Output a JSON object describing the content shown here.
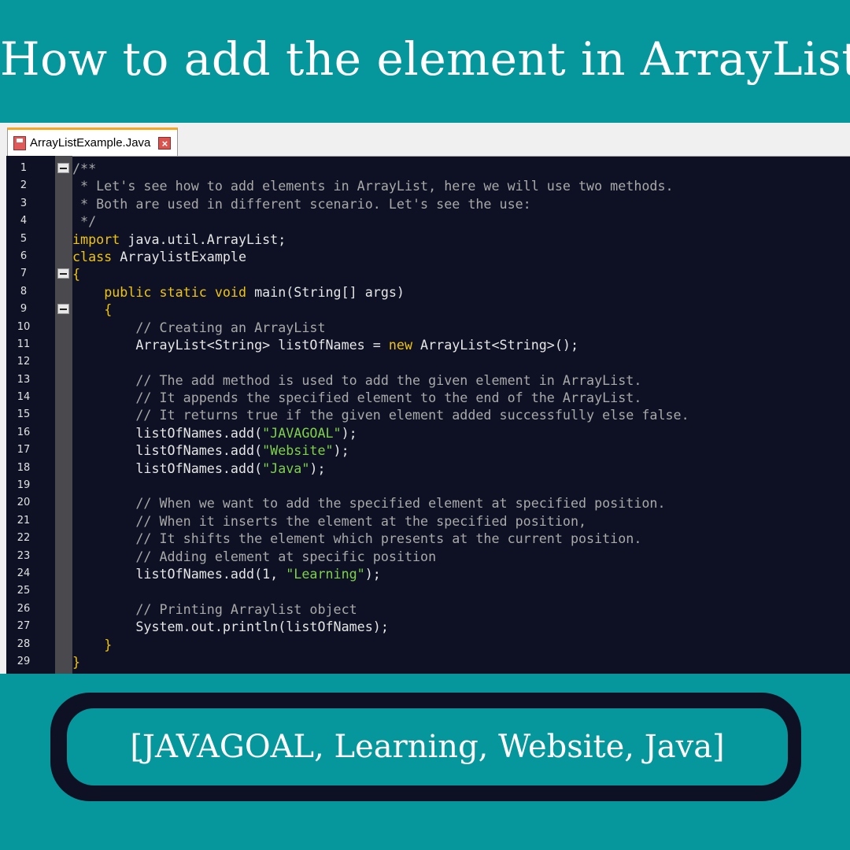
{
  "header": {
    "title": "How to add the element in ArrayList"
  },
  "editor": {
    "tab_label": "ArrayListExample.Java",
    "colors": {
      "background": "#0d1123",
      "comment": "#a9a9a9",
      "keyword": "#f1c40f",
      "string": "#7fd14a",
      "text": "#e6e6e6"
    },
    "lines": [
      {
        "n": "1",
        "fold": true,
        "tokens": [
          {
            "t": "/**",
            "c": "comment"
          }
        ]
      },
      {
        "n": "2",
        "tokens": [
          {
            "t": " * Let's see how to add elements in ArrayList, here we will use two methods.",
            "c": "comment"
          }
        ]
      },
      {
        "n": "3",
        "tokens": [
          {
            "t": " * Both are used in different scenario. Let's see the use:",
            "c": "comment"
          }
        ]
      },
      {
        "n": "4",
        "tokens": [
          {
            "t": " */",
            "c": "comment"
          }
        ]
      },
      {
        "n": "5",
        "tokens": [
          {
            "t": "import",
            "c": "kw"
          },
          {
            "t": " java.util.ArrayList;",
            "c": "plain"
          }
        ]
      },
      {
        "n": "6",
        "tokens": [
          {
            "t": "class",
            "c": "kw"
          },
          {
            "t": " ArraylistExample",
            "c": "plain"
          }
        ]
      },
      {
        "n": "7",
        "fold": true,
        "tokens": [
          {
            "t": "{",
            "c": "brace"
          }
        ]
      },
      {
        "n": "8",
        "tokens": [
          {
            "t": "    ",
            "c": "plain"
          },
          {
            "t": "public static void",
            "c": "kw"
          },
          {
            "t": " main(String[] args)",
            "c": "plain"
          }
        ]
      },
      {
        "n": "9",
        "fold": true,
        "tokens": [
          {
            "t": "    ",
            "c": "plain"
          },
          {
            "t": "{",
            "c": "brace"
          }
        ]
      },
      {
        "n": "10",
        "tokens": [
          {
            "t": "        // Creating an ArrayList",
            "c": "comment"
          }
        ]
      },
      {
        "n": "11",
        "tokens": [
          {
            "t": "        ArrayList<String> listOfNames = ",
            "c": "plain"
          },
          {
            "t": "new",
            "c": "kw"
          },
          {
            "t": " ArrayList<String>();",
            "c": "plain"
          }
        ]
      },
      {
        "n": "12",
        "tokens": []
      },
      {
        "n": "13",
        "tokens": [
          {
            "t": "        // The add method is used to add the given element in ArrayList.",
            "c": "comment"
          }
        ]
      },
      {
        "n": "14",
        "tokens": [
          {
            "t": "        // It appends the specified element to the end of the ArrayList.",
            "c": "comment"
          }
        ]
      },
      {
        "n": "15",
        "tokens": [
          {
            "t": "        // It returns true if the given element added successfully else false.",
            "c": "comment"
          }
        ]
      },
      {
        "n": "16",
        "tokens": [
          {
            "t": "        listOfNames.add(",
            "c": "plain"
          },
          {
            "t": "\"JAVAGOAL\"",
            "c": "str"
          },
          {
            "t": ");",
            "c": "plain"
          }
        ]
      },
      {
        "n": "17",
        "tokens": [
          {
            "t": "        listOfNames.add(",
            "c": "plain"
          },
          {
            "t": "\"Website\"",
            "c": "str"
          },
          {
            "t": ");",
            "c": "plain"
          }
        ]
      },
      {
        "n": "18",
        "tokens": [
          {
            "t": "        listOfNames.add(",
            "c": "plain"
          },
          {
            "t": "\"Java\"",
            "c": "str"
          },
          {
            "t": ");",
            "c": "plain"
          }
        ]
      },
      {
        "n": "19",
        "tokens": []
      },
      {
        "n": "20",
        "tokens": [
          {
            "t": "        // When we want to add the specified element at specified position.",
            "c": "comment"
          }
        ]
      },
      {
        "n": "21",
        "tokens": [
          {
            "t": "        // When it inserts the element at the specified position,",
            "c": "comment"
          }
        ]
      },
      {
        "n": "22",
        "tokens": [
          {
            "t": "        // It shifts the element which presents at the current position.",
            "c": "comment"
          }
        ]
      },
      {
        "n": "23",
        "tokens": [
          {
            "t": "        // Adding element at specific position",
            "c": "comment"
          }
        ]
      },
      {
        "n": "24",
        "tokens": [
          {
            "t": "        listOfNames.add(1, ",
            "c": "plain"
          },
          {
            "t": "\"Learning\"",
            "c": "str"
          },
          {
            "t": ");",
            "c": "plain"
          }
        ]
      },
      {
        "n": "25",
        "tokens": []
      },
      {
        "n": "26",
        "tokens": [
          {
            "t": "        // Printing Arraylist object",
            "c": "comment"
          }
        ]
      },
      {
        "n": "27",
        "tokens": [
          {
            "t": "        System.out.println(listOfNames);",
            "c": "plain"
          }
        ]
      },
      {
        "n": "28",
        "tokens": [
          {
            "t": "    ",
            "c": "plain"
          },
          {
            "t": "}",
            "c": "brace"
          }
        ]
      },
      {
        "n": "29",
        "tokens": [
          {
            "t": "}",
            "c": "brace"
          }
        ]
      }
    ]
  },
  "output": {
    "text": "[JAVAGOAL, Learning, Website, Java]"
  }
}
